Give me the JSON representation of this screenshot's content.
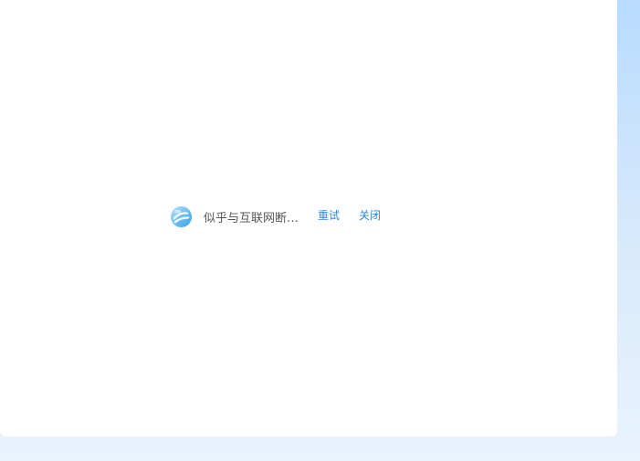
{
  "notice": {
    "icon": "globe-disconnected-icon",
    "message": "似乎与互联网断开了连接",
    "retry_label": "重试",
    "close_label": "关闭",
    "link_color": "#2e86de"
  }
}
